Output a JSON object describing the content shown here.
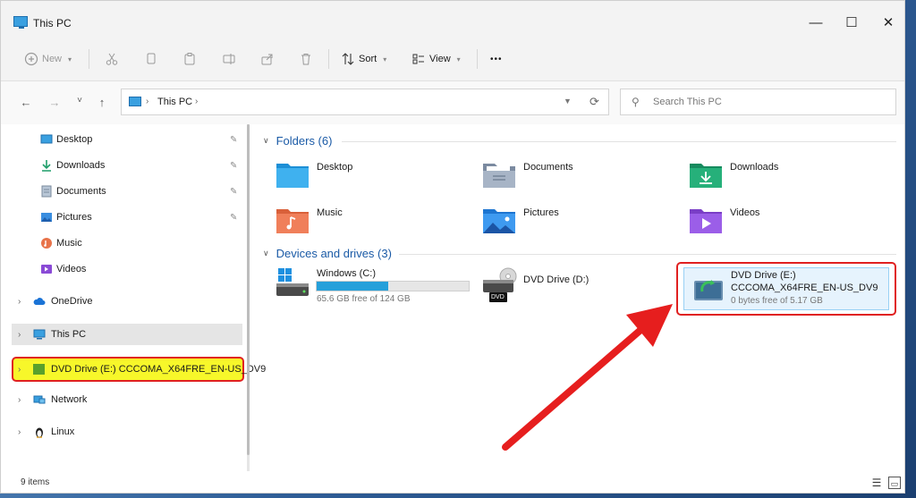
{
  "window": {
    "title": "This PC"
  },
  "window_controls": {
    "minimize": "—",
    "maximize": "☐",
    "close": "✕"
  },
  "toolbar": {
    "new_label": "New",
    "sort_label": "Sort",
    "view_label": "View",
    "more_label": "•••"
  },
  "nav": {
    "back": "←",
    "forward": "→",
    "recent": "˅",
    "up": "↑"
  },
  "address": {
    "crumb": "This PC",
    "chev": "›"
  },
  "search": {
    "placeholder": "Search This PC"
  },
  "sidebar": {
    "quick_access": [
      {
        "label": "Desktop",
        "icon": "desktop-icon"
      },
      {
        "label": "Downloads",
        "icon": "download-icon"
      },
      {
        "label": "Documents",
        "icon": "documents-icon"
      },
      {
        "label": "Pictures",
        "icon": "pictures-icon"
      },
      {
        "label": "Music",
        "icon": "music-icon"
      },
      {
        "label": "Videos",
        "icon": "videos-icon"
      }
    ],
    "onedrive": "OneDrive",
    "this_pc": "This PC",
    "dvd_drive": "DVD Drive (E:) CCCOMA_X64FRE_EN-US_DV9",
    "network": "Network",
    "linux": "Linux"
  },
  "folders": {
    "heading": "Folders (6)",
    "items": [
      "Desktop",
      "Documents",
      "Downloads",
      "Music",
      "Pictures",
      "Videos"
    ]
  },
  "drives": {
    "heading": "Devices and drives (3)",
    "windows": {
      "name": "Windows (C:)",
      "free": "65.6 GB free of 124 GB",
      "used_fraction": 0.47
    },
    "dvd_d": {
      "name": "DVD Drive (D:)",
      "badge": "DVD"
    },
    "dvd_e": {
      "name": "DVD Drive (E:)",
      "label": "CCCOMA_X64FRE_EN-US_DV9",
      "free": "0 bytes free of 5.17 GB"
    }
  },
  "status": {
    "items": "9 items"
  },
  "colors": {
    "accent": "#1a5aa6",
    "highlight_red": "#e02020",
    "highlight_yellow": "#f7f72a",
    "bar_fill": "#26a0da"
  }
}
